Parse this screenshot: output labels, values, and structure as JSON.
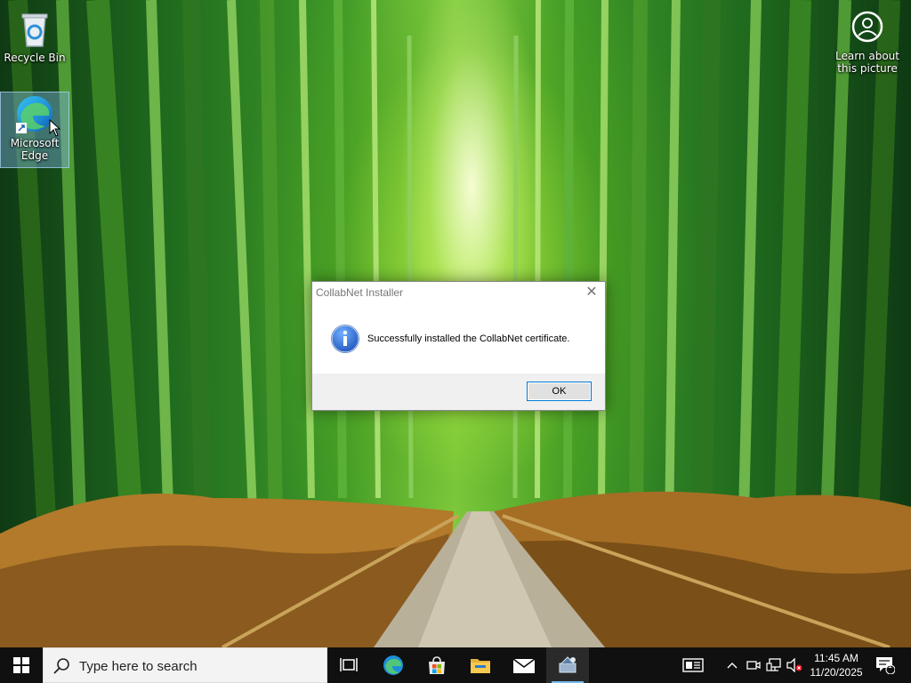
{
  "desktop": {
    "icons": [
      {
        "label": "Recycle Bin"
      },
      {
        "label": "Microsoft Edge"
      },
      {
        "label": "Learn about this picture"
      }
    ]
  },
  "dialog": {
    "title": "CollabNet Installer",
    "close_glyph": "✕",
    "message": "Successfully installed the CollabNet certificate.",
    "ok_label": "OK",
    "icon": "info-icon"
  },
  "taskbar": {
    "search_placeholder": "Type here to search",
    "pinned": [
      "start-icon",
      "task-view-icon",
      "edge-icon",
      "store-icon",
      "file-explorer-icon",
      "mail-icon",
      "installer-icon"
    ],
    "tray": {
      "time": "11:45 AM",
      "date": "11/20/2025",
      "notification_count": "1"
    }
  },
  "colors": {
    "accent": "#0078d7",
    "taskbar": "#101010",
    "active_indicator": "#76b9ed"
  }
}
